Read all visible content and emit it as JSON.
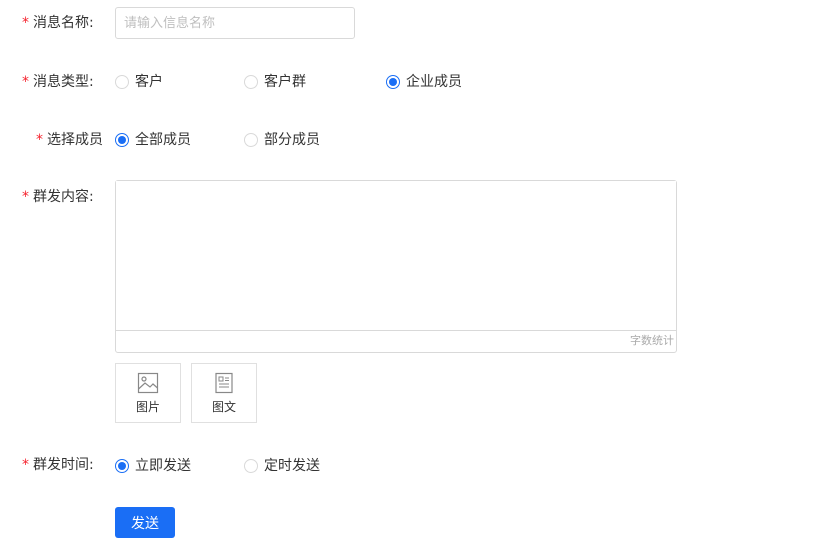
{
  "form": {
    "required_mark": "*",
    "message_name": {
      "label": "消息名称:",
      "placeholder": "请输入信息名称",
      "value": ""
    },
    "message_type": {
      "label": "消息类型:",
      "options": [
        "客户",
        "客户群",
        "企业成员"
      ],
      "selected": "企业成员"
    },
    "member_select": {
      "label": "选择成员",
      "options": [
        "全部成员",
        "部分成员"
      ],
      "selected": "全部成员"
    },
    "content": {
      "label": "群发内容:",
      "value": "",
      "word_count": "字数统计",
      "attachments": [
        {
          "label": "图片",
          "icon": "image-icon"
        },
        {
          "label": "图文",
          "icon": "article-icon"
        }
      ]
    },
    "send_time": {
      "label": "群发时间:",
      "options": [
        "立即发送",
        "定时发送"
      ],
      "selected": "立即发送"
    },
    "submit_label": "发送"
  },
  "colors": {
    "primary": "#1a6ef5",
    "required": "#f5222d",
    "border": "#d9d9d9"
  }
}
